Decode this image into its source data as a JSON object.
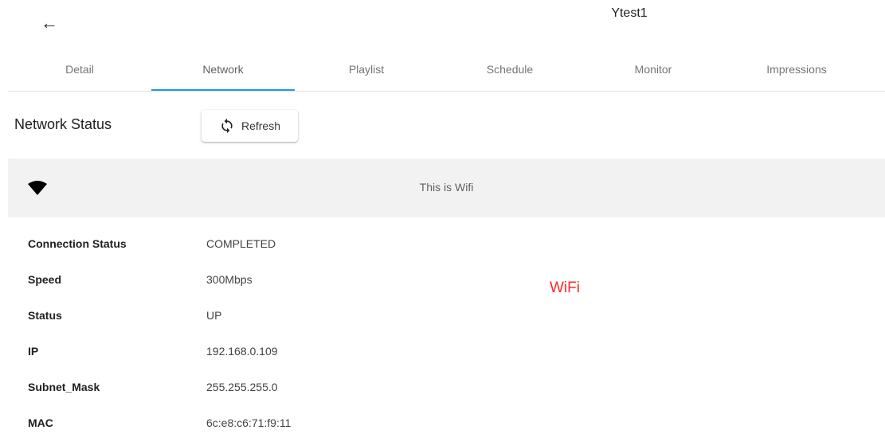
{
  "header": {
    "back_icon": "arrow-left-icon",
    "title": "Ytest1"
  },
  "tabs": [
    {
      "label": "Detail",
      "active": false
    },
    {
      "label": "Network",
      "active": true
    },
    {
      "label": "Playlist",
      "active": false
    },
    {
      "label": "Schedule",
      "active": false
    },
    {
      "label": "Monitor",
      "active": false
    },
    {
      "label": "Impressions",
      "active": false
    }
  ],
  "network": {
    "section_title": "Network Status",
    "refresh_label": "Refresh",
    "refresh_icon": "refresh-icon",
    "connection_icon": "wifi-icon",
    "connection_caption": "This is Wifi",
    "annotation": "WiFi",
    "annotation_color": "#ff2a2a",
    "accent_color": "#2196f3",
    "rows": [
      {
        "label": "Connection Status",
        "value": "COMPLETED"
      },
      {
        "label": "Speed",
        "value": "300Mbps"
      },
      {
        "label": "Status",
        "value": "UP"
      },
      {
        "label": "IP",
        "value": "192.168.0.109"
      },
      {
        "label": "Subnet_Mask",
        "value": "255.255.255.0"
      },
      {
        "label": "MAC",
        "value": "6c:e8:c6:71:f9:11"
      }
    ]
  }
}
